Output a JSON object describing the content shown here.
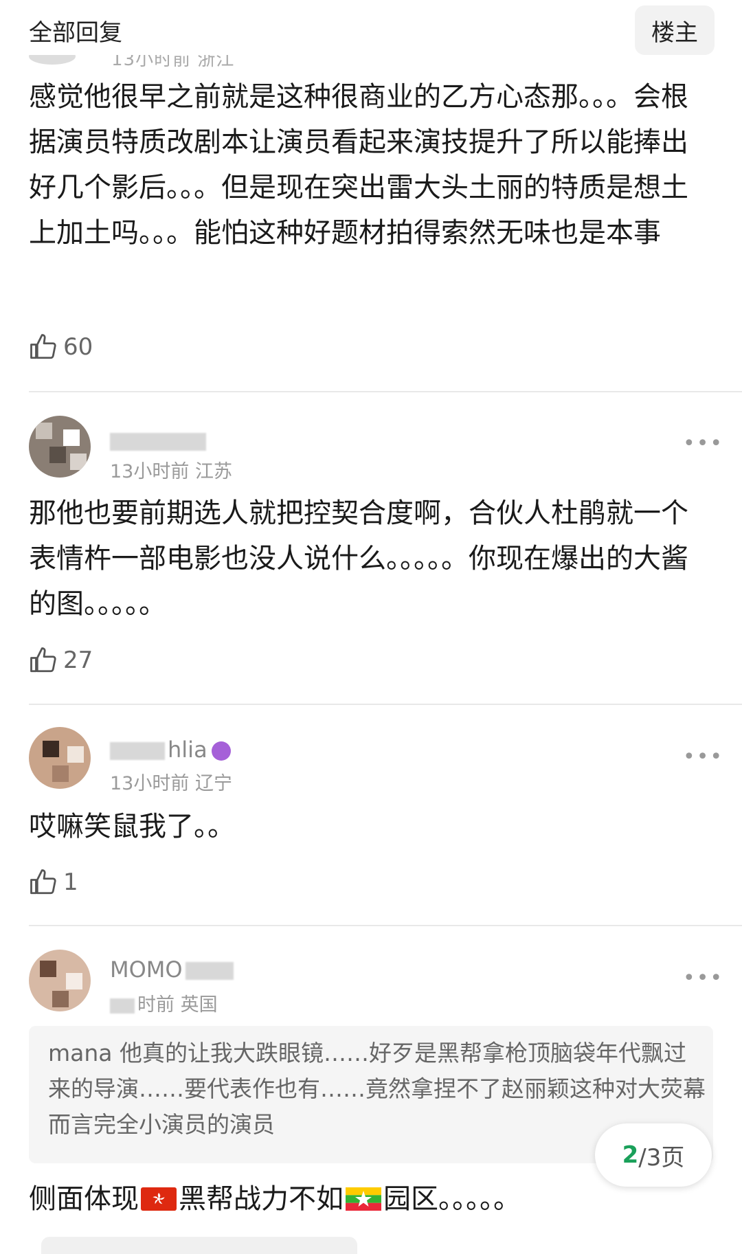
{
  "header": {
    "title": "全部回复",
    "owner_button": "楼主"
  },
  "top_comment": {
    "meta_faded": "13小时前 浙江",
    "text": "感觉他很早之前就是这种很商业的乙方心态那。。。会根据演员特质改剧本让演员看起来演技提升了所以能捧出好几个影后。。。但是现在突出雷大头土丽的特质是想土上加土吗。。。能怕这种好题材拍得索然无味也是本事",
    "likes": "60"
  },
  "comments": [
    {
      "meta": "13小时前 江苏",
      "text": "那他也要前期选人就把控契合度啊，合伙人杜鹃就一个表情杵一部电影也没人说什么。。。。。你现在爆出的大酱的图。。。。。",
      "likes": "27"
    },
    {
      "username_visible": "hlia",
      "meta": "13小时前 辽宁",
      "text": "哎嘛笑鼠我了。。",
      "likes": "1"
    },
    {
      "username_visible": "MOMO",
      "meta": "时前 英国",
      "quote": "mana 他真的让我大跌眼镜……好歹是黑帮拿枪顶脑袋年代飘过来的导演……要代表作也有……竟然拿捏不了赵丽颖这种对大荧幕而言完全小演员的演员",
      "text_part1": "侧面体现",
      "text_part2": "黑帮战力不如",
      "text_part3": "园区。。。。。"
    }
  ],
  "pager": {
    "current": "2",
    "total_suffix": "/3页"
  },
  "icons": {
    "like": "thumbs-up-icon",
    "more": "more-dots-icon",
    "hk_flag": "hong-kong-flag-icon",
    "mm_flag": "myanmar-flag-icon"
  },
  "colors": {
    "accent_green": "#1aa05a",
    "meta_gray": "#9a9a9a"
  }
}
